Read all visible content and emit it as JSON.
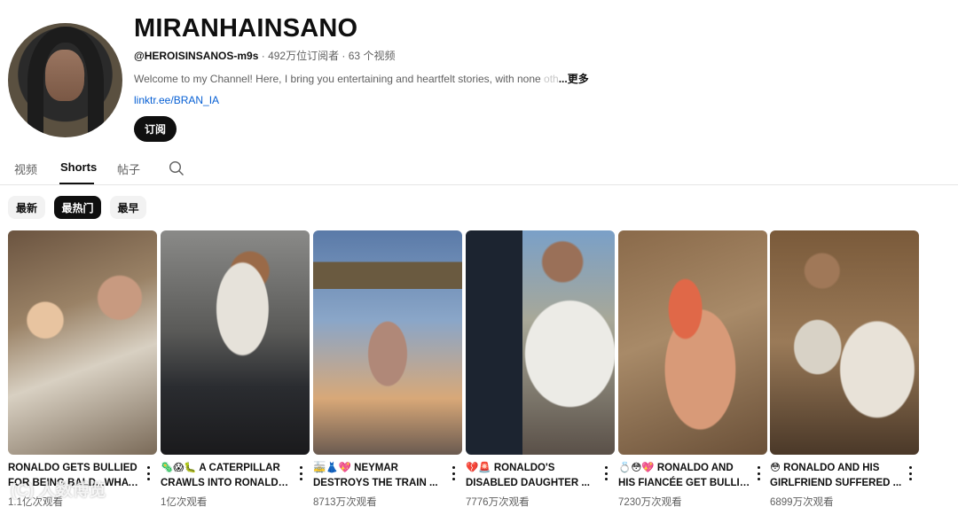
{
  "channel": {
    "name": "MIRANHAINSANO",
    "handle": "@HEROISINSANOS-m9s",
    "stats": " · 492万位订阅者 · 63 个视频",
    "description": "Welcome to my Channel! Here, I bring you entertaining and heartfelt stories, with none",
    "description_faded": " oth",
    "more": "...更多",
    "link": "linktr.ee/BRAN_IA",
    "subscribe": "订阅"
  },
  "tabs": [
    "视频",
    "Shorts",
    "帖子"
  ],
  "active_tab": "Shorts",
  "icons": {
    "search": "search-icon",
    "more": "more-vert-icon"
  },
  "chips": [
    "最新",
    "最热门",
    "最早"
  ],
  "active_chip": "最热门",
  "shorts": [
    {
      "title_1": "RONALDO GETS BULLIED",
      "title_2": "FOR BEING BALD...WHAT ...",
      "views": "1.1亿次观看"
    },
    {
      "title_1": "🦠😱🐛 A CATERPILLAR",
      "title_2": "CRAWLS INTO RONALDO'...",
      "views": "1亿次观看"
    },
    {
      "title_1": "🚋👗💖 NEYMAR",
      "title_2": "DESTROYS THE TRAIN ...",
      "views": "8713万次观看"
    },
    {
      "title_1": "💔🚨 RONALDO'S",
      "title_2": "DISABLED DAUGHTER ...",
      "views": "7776万次观看"
    },
    {
      "title_1": "💍😳💖 RONALDO AND",
      "title_2": "HIS FIANCÉE GET BULLIE...",
      "views": "7230万次观看"
    },
    {
      "title_1": "😳 RONALDO AND HIS",
      "title_2": "GIRLFRIEND SUFFERED ...",
      "views": "6899万次观看"
    }
  ],
  "watermark": "(C) 人数博览",
  "colors": {
    "accent": "#065fd4",
    "text": "#0f0f0f",
    "secondary": "#606060",
    "chip_bg": "#f2f2f2"
  }
}
